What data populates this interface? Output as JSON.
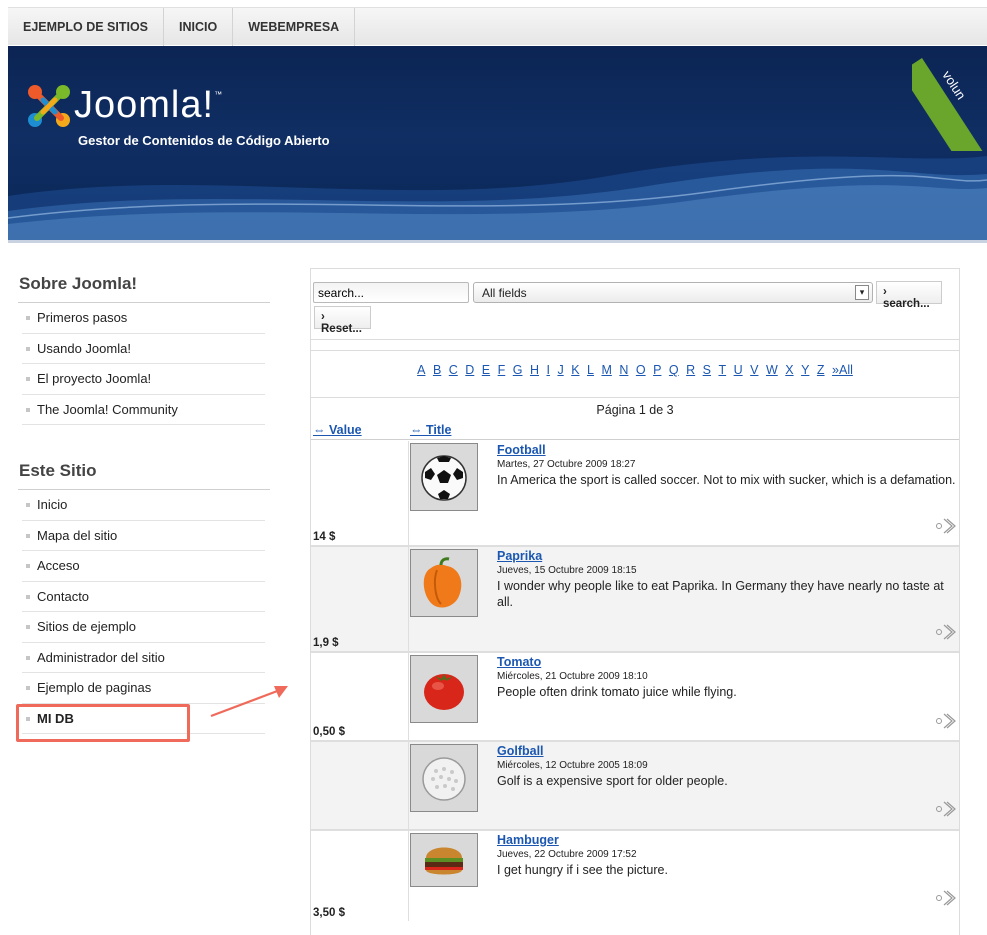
{
  "topnav": {
    "items": [
      {
        "label": "EJEMPLO DE SITIOS"
      },
      {
        "label": "INICIO"
      },
      {
        "label": "WEBEMPRESA"
      }
    ]
  },
  "header": {
    "brand": "Joomla!",
    "tm": "™",
    "slogan": "Gestor de Contenidos de Código Abierto",
    "corner_text": "volun",
    "corner_color": "#6aa52c"
  },
  "sidebar": {
    "section1": {
      "title": "Sobre Joomla!",
      "items": [
        {
          "label": "Primeros pasos"
        },
        {
          "label": "Usando Joomla!"
        },
        {
          "label": "El proyecto Joomla!"
        },
        {
          "label": "The Joomla! Community"
        }
      ]
    },
    "section2": {
      "title": "Este Sitio",
      "items": [
        {
          "label": "Inicio"
        },
        {
          "label": "Mapa del sitio"
        },
        {
          "label": "Acceso"
        },
        {
          "label": "Contacto"
        },
        {
          "label": "Sitios de ejemplo"
        },
        {
          "label": "Administrador del sitio"
        },
        {
          "label": "Ejemplo de paginas"
        },
        {
          "label": "MI DB"
        }
      ]
    },
    "highlight_color": "#ef6a5a"
  },
  "search": {
    "input_value": "search...",
    "field_select": "All fields",
    "search_button": "› search...",
    "reset_button": "› Reset..."
  },
  "alphabet": [
    "A",
    "B",
    "C",
    "D",
    "E",
    "F",
    "G",
    "H",
    "I",
    "J",
    "K",
    "L",
    "M",
    "N",
    "O",
    "P",
    "Q",
    "R",
    "S",
    "T",
    "U",
    "V",
    "W",
    "X",
    "Y",
    "Z",
    "»All"
  ],
  "pagination": {
    "info": "Página 1 de 3"
  },
  "columns": {
    "value": "⇔ Value",
    "title": "⇔ Title"
  },
  "rows": [
    {
      "price": "14 $",
      "title": "Football",
      "date": "Martes, 27 Octubre 2009 18:27",
      "text": "In America the sport is called soccer. Not to mix with sucker, which is a defamation.",
      "image": "football-icon"
    },
    {
      "price": "1,9 $",
      "title": "Paprika",
      "date": "Jueves, 15 Octubre 2009 18:15",
      "text": "I wonder why people like to eat Paprika. In Germany they have nearly no taste at all.",
      "image": "paprika-icon"
    },
    {
      "price": "0,50 $",
      "title": "Tomato",
      "date": "Miércoles, 21 Octubre 2009 18:10",
      "text": "People often drink tomato juice while flying.",
      "image": "tomato-icon"
    },
    {
      "price": "",
      "title": "Golfball",
      "date": "Miércoles, 12 Octubre 2005 18:09",
      "text": "Golf is a expensive sport for older people.",
      "image": "golfball-icon"
    },
    {
      "price": "3,50 $",
      "title": "Hambuger",
      "date": "Jueves, 22 Octubre 2009 17:52",
      "text": "I get hungry if i see the picture.",
      "image": "hamburger-icon"
    }
  ]
}
